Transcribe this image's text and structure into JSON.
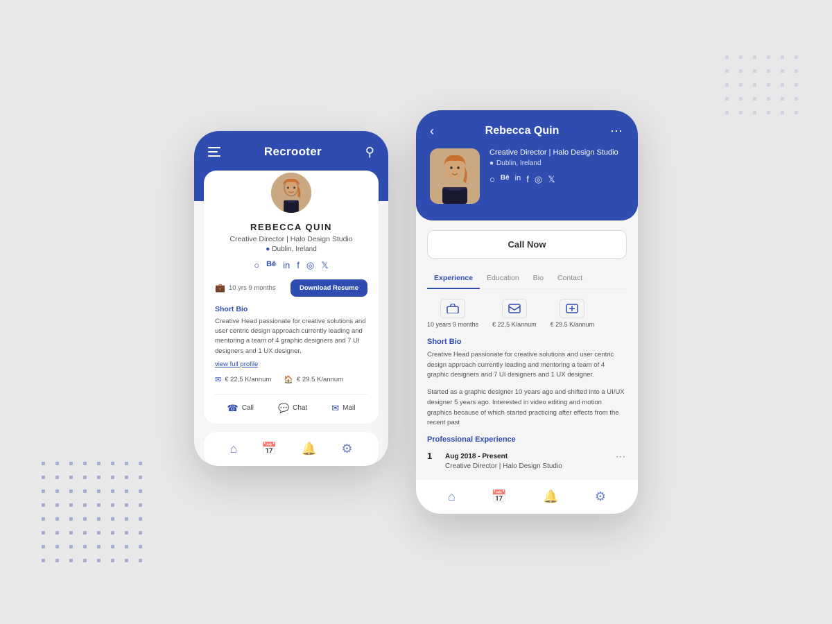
{
  "app": {
    "title": "Recrooter",
    "bg_color": "#e8e8e8",
    "accent_color": "#2f4db0"
  },
  "phone1": {
    "header": {
      "title": "Recrooter",
      "menu_icon": "menu-icon",
      "search_icon": "search-icon"
    },
    "profile": {
      "name": "REBECCA QUIN",
      "job_title": "Creative Director | Halo Design Studio",
      "location": "Dublin, Ireland",
      "experience": "10 yrs 9 months",
      "download_resume": "Download Resume",
      "short_bio_title": "Short Bio",
      "bio": "Creative Head passionate for creative solutions and user centric design approach currently leading and mentoring a team of 4 graphic designers and 7 UI  designers and 1 UX designer,",
      "view_full_profile": "view full profile",
      "salary_min": "€ 22,5 K/annum",
      "salary_max": "€ 29.5 K/annum"
    },
    "actions": {
      "call": "Call",
      "chat": "Chat",
      "mail": "Mail"
    },
    "social": [
      "website",
      "behance",
      "linkedin",
      "facebook",
      "instagram",
      "twitter"
    ],
    "nav": [
      "home",
      "calendar",
      "bell",
      "settings"
    ]
  },
  "phone2": {
    "header": {
      "name": "Rebecca Quin",
      "back_icon": "back-icon",
      "more_icon": "more-icon",
      "job_title": "Creative Director | Halo Design Studio",
      "location": "Dublin, Ireland"
    },
    "call_now": "Call Now",
    "tabs": [
      "Experience",
      "Education",
      "Bio",
      "Contact"
    ],
    "active_tab": "Experience",
    "stats": [
      {
        "label": "10 years 9 months",
        "icon": "briefcase-icon"
      },
      {
        "label": "€ 22,5 K/annum",
        "icon": "email-icon"
      },
      {
        "label": "€ 29.5 K/annum",
        "icon": "salary-icon"
      }
    ],
    "short_bio_title": "Short Bio",
    "bio1": "Creative Head passionate for creative solutions and user centric design approach currently leading and mentoring a team of 4 graphic designers and 7 UI  designers and 1 UX designer.",
    "bio2": "Started as a graphic designer 10 years ago and shifted into a UI/UX designer 5 years ago. Interested in video editing and motion graphics because of which started practicing after effects from the recent past",
    "professional_exp_title": "Professional Experience",
    "experience_entry": {
      "num": "1",
      "date": "Aug 2018 - Present",
      "job_title": "Creative Director | Halo Design Studio"
    },
    "social": [
      "website",
      "behance",
      "linkedin",
      "facebook",
      "instagram",
      "twitter"
    ],
    "nav": [
      "home",
      "calendar",
      "bell",
      "settings"
    ]
  }
}
